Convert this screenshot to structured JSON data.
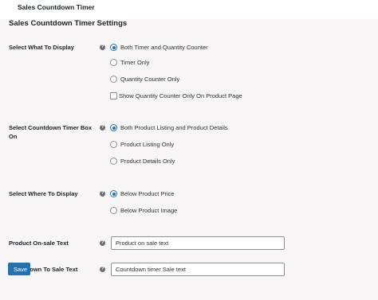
{
  "window": {
    "title": "Sales Countdown Timer"
  },
  "settings": {
    "title": "Sales Countdown Timer Settings",
    "display": {
      "label": "Select What To Display",
      "help": "?",
      "options": [
        "Both Timer and Quantity Counter",
        "Timer Only",
        "Quantity Counter Only"
      ],
      "selected": "Both Timer and Quantity Counter",
      "checkbox_label": "Show Quantity Counter Only On Product Page",
      "checkbox_checked": false
    },
    "box": {
      "label_line1": "Select Countdown Timer Box",
      "label_line2": "On",
      "help": "?",
      "options": [
        "Both Product Listing and Product Details",
        "Product Listing Only",
        "Product Details Only"
      ],
      "selected": "Both Product Listing and Product Details"
    },
    "where": {
      "label": "Select Where To Display",
      "help": "?",
      "options": [
        "Below Product Price",
        "Below Product Image"
      ],
      "selected": "Below Product Price"
    },
    "onsale": {
      "label": "Product On-sale Text",
      "help": "?",
      "value": "Product on sale text"
    },
    "countdown": {
      "label": "Countdown To Sale Text",
      "help": "?",
      "value": "Countdown timer Sale text"
    },
    "save_label": "Save"
  },
  "colors": {
    "accent": "#2271b1",
    "background": "#f7f5f5",
    "topbar": "#ffffff",
    "text": "#1d2327",
    "help_icon": "#6b6f73"
  },
  "icons": {
    "help": "help-circle-icon"
  }
}
